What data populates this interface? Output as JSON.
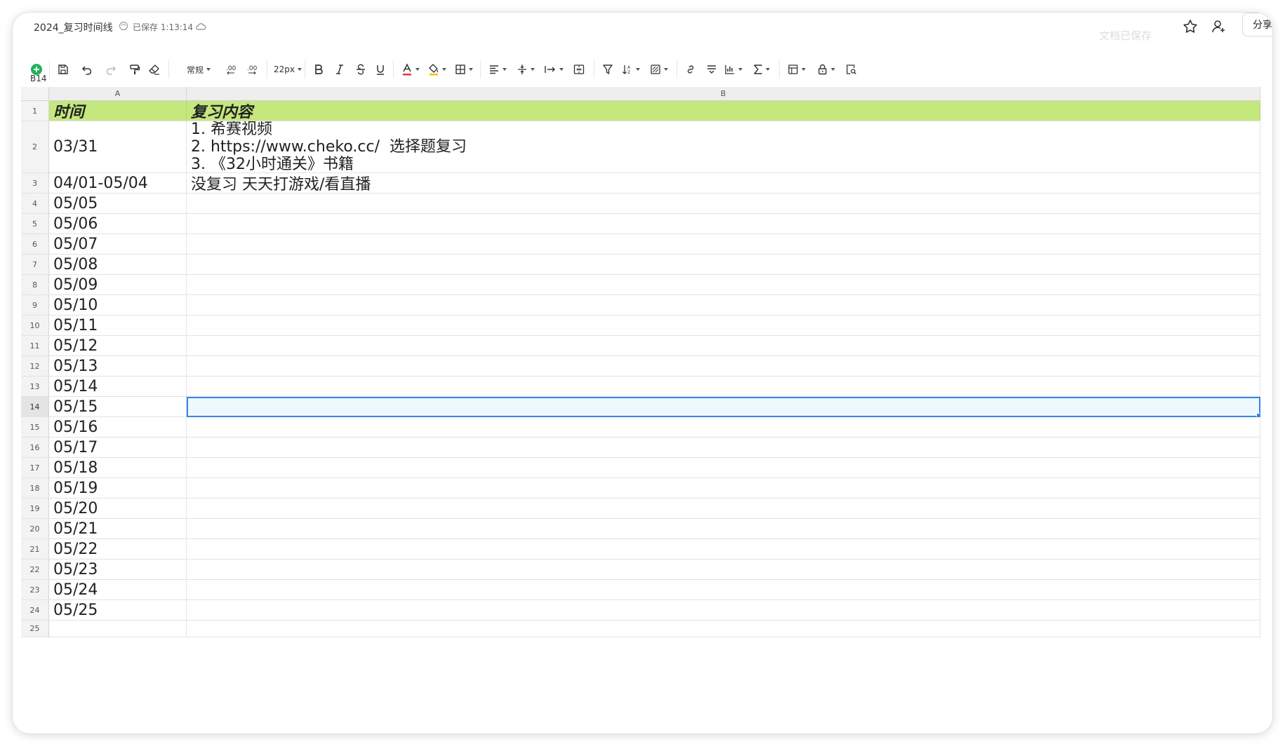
{
  "topbar": {
    "title": "2024_复习时间线",
    "save_status": "已保存 1:13:14",
    "toast": "文档已保存",
    "share_label": "分享"
  },
  "toolbar": {
    "format_label": "常规",
    "font_size_label": "22px",
    "items": [
      "add",
      "save",
      "undo",
      "redo",
      "format-painter",
      "clear-format",
      "number-format",
      "decrease-decimal",
      "increase-decimal",
      "font-size",
      "bold",
      "italic",
      "strikethrough",
      "underline",
      "font-color",
      "fill-color",
      "borders",
      "horizontal-align",
      "vertical-align",
      "text-wrap",
      "merge-cells",
      "filter",
      "sort",
      "conditional-format",
      "link",
      "freeze",
      "chart",
      "sum",
      "table-style",
      "lock",
      "find"
    ]
  },
  "accent_colors": {
    "header_fill": "#c4e77e",
    "selection": "#3585e8",
    "selection_fill": "#eef8fd",
    "add_button": "#1fb35b",
    "font_color_bar": "#e0393e",
    "fill_color_bar": "#f2c200"
  },
  "cell_ref": "B14",
  "grid": {
    "col_headers": [
      "A",
      "B"
    ],
    "selected_cell": "B14",
    "rows": [
      {
        "num": "1",
        "a": "时间",
        "b": "复习内容",
        "header": true
      },
      {
        "num": "2",
        "a": "03/31",
        "b_lines": [
          "1. 希赛视频",
          "2. https://www.cheko.cc/  选择题复习",
          "3. 《32小时通关》书籍"
        ]
      },
      {
        "num": "3",
        "a": "04/01-05/04",
        "b": "没复习 天天打游戏/看直播"
      },
      {
        "num": "4",
        "a": "05/05",
        "b": ""
      },
      {
        "num": "5",
        "a": "05/06",
        "b": ""
      },
      {
        "num": "6",
        "a": "05/07",
        "b": ""
      },
      {
        "num": "7",
        "a": "05/08",
        "b": ""
      },
      {
        "num": "8",
        "a": "05/09",
        "b": ""
      },
      {
        "num": "9",
        "a": "05/10",
        "b": ""
      },
      {
        "num": "10",
        "a": "05/11",
        "b": ""
      },
      {
        "num": "11",
        "a": "05/12",
        "b": ""
      },
      {
        "num": "12",
        "a": "05/13",
        "b": ""
      },
      {
        "num": "13",
        "a": "05/14",
        "b": ""
      },
      {
        "num": "14",
        "a": "05/15",
        "b": "",
        "selected": true
      },
      {
        "num": "15",
        "a": "05/16",
        "b": ""
      },
      {
        "num": "16",
        "a": "05/17",
        "b": ""
      },
      {
        "num": "17",
        "a": "05/18",
        "b": ""
      },
      {
        "num": "18",
        "a": "05/19",
        "b": ""
      },
      {
        "num": "19",
        "a": "05/20",
        "b": ""
      },
      {
        "num": "20",
        "a": "05/21",
        "b": ""
      },
      {
        "num": "21",
        "a": "05/22",
        "b": ""
      },
      {
        "num": "22",
        "a": "05/23",
        "b": ""
      },
      {
        "num": "23",
        "a": "05/24",
        "b": ""
      },
      {
        "num": "24",
        "a": "05/25",
        "b": ""
      },
      {
        "num": "25",
        "a": "",
        "b": ""
      }
    ]
  }
}
